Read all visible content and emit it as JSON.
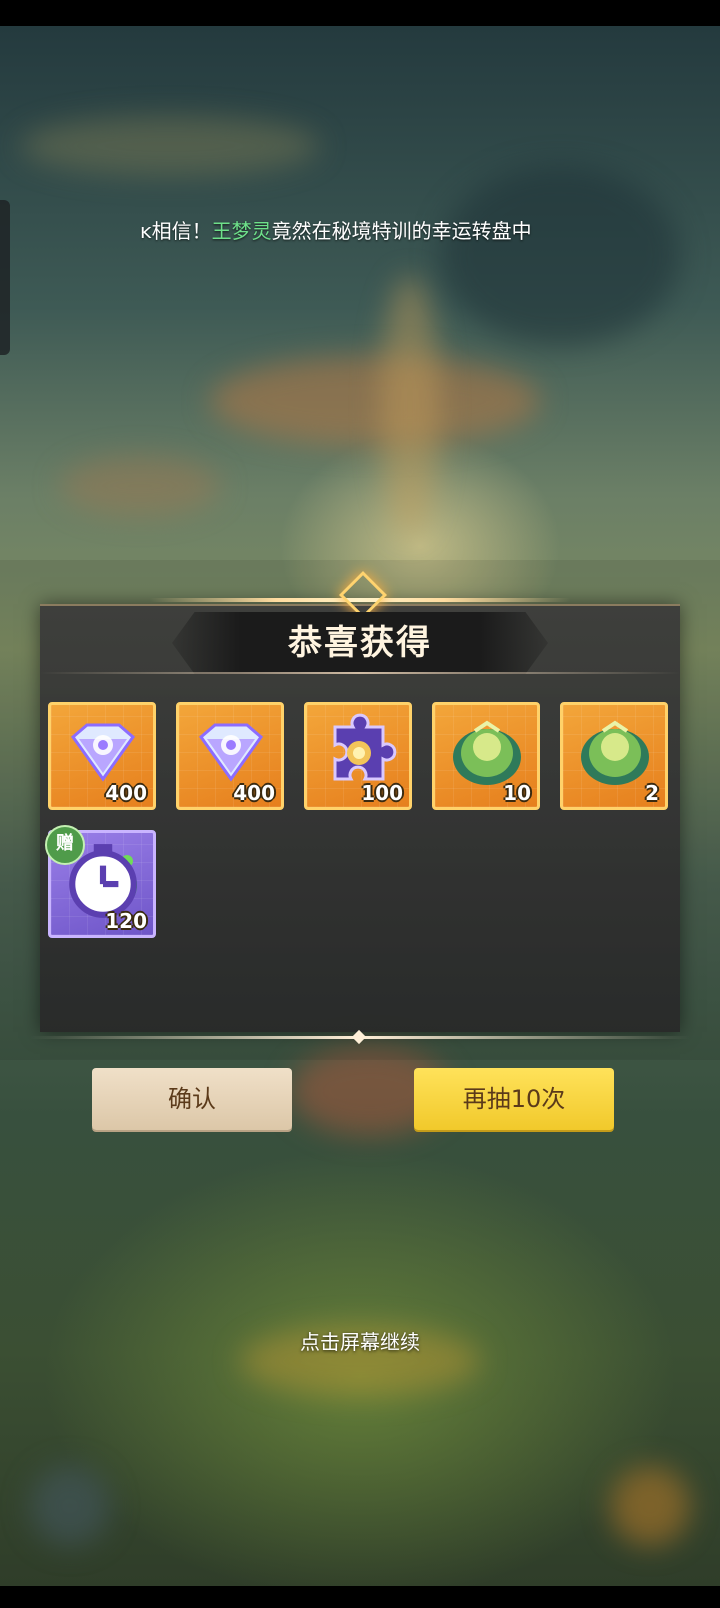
{
  "marquee": {
    "prefix": "ᴋ相信！",
    "highlight_name": "王梦灵",
    "suffix": "竟然在秘境特训的幸运转盘中"
  },
  "panel": {
    "title": "恭喜获得"
  },
  "items": [
    {
      "icon": "diamond-gem-icon",
      "qty": "400"
    },
    {
      "icon": "diamond-gem-icon",
      "qty": "400"
    },
    {
      "icon": "puzzle-piece-icon",
      "qty": "100"
    },
    {
      "icon": "green-cabbage-icon",
      "qty": "10"
    },
    {
      "icon": "green-cabbage-icon",
      "qty": "2"
    },
    {
      "icon": "green-slime-orb-icon",
      "qty": "120",
      "badge": "赠"
    }
  ],
  "buttons": {
    "confirm": "确认",
    "draw_again": "再抽10次"
  },
  "hint": "点击屏幕继续",
  "colors": {
    "gold_frame": "#ffd26a",
    "orange_bg": "#e67f1d",
    "purple_bg": "#6e55c8",
    "button_yellow": "#f1c92b",
    "button_beige": "#dcc7a8",
    "name_green": "#6ee08a"
  }
}
